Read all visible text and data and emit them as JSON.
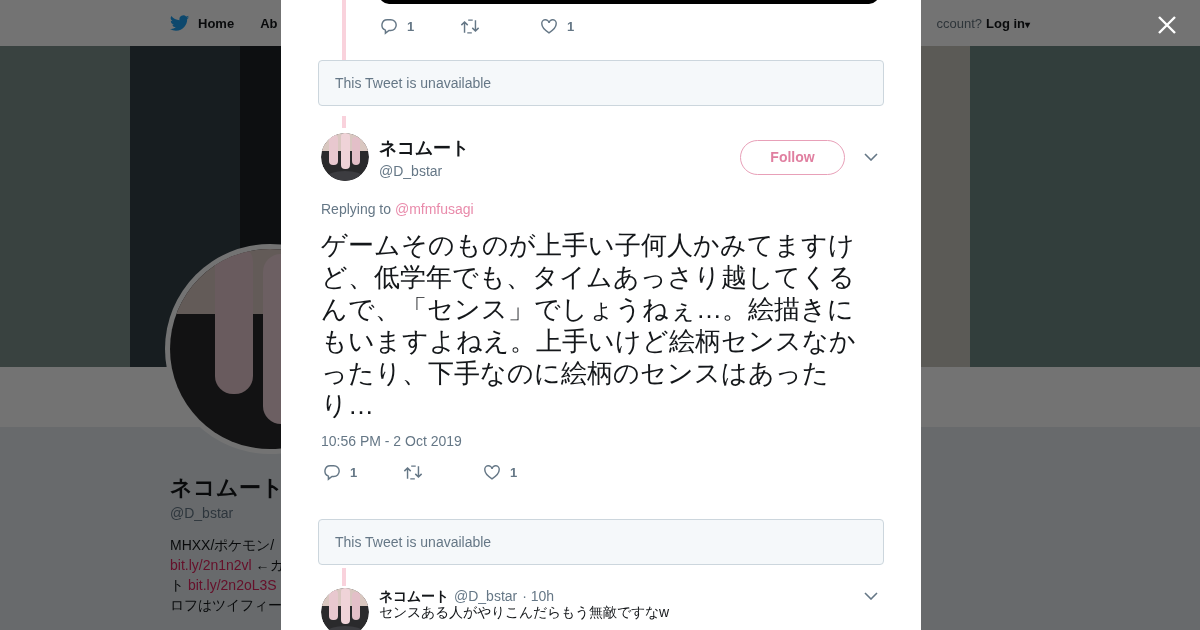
{
  "nav": {
    "items": [
      {
        "label": "Home"
      },
      {
        "label": "Ab"
      }
    ],
    "account_prompt": "ccount?",
    "login": "Log in",
    "login_caret": "▾"
  },
  "profile": {
    "name": "ネコムート",
    "handle": "@D_bstar",
    "bio": [
      {
        "kind": "text",
        "text": "MHXX/ポケモン/"
      },
      {
        "kind": "mixed",
        "link": "bit.ly/2n1n2vl",
        "text": "←カ"
      },
      {
        "kind": "mixed_pre",
        "pre": "ト",
        "link": "bit.ly/2n2oL3S"
      },
      {
        "kind": "text",
        "text": "ロフはツイフィー"
      }
    ]
  },
  "modal": {
    "previous_tweet": {
      "reply_count": "1",
      "like_count": "1"
    },
    "unavailable_1": "This Tweet is unavailable",
    "tweet": {
      "name": "ネコムート",
      "handle": "@D_bstar",
      "follow": "Follow",
      "replying_label": "Replying to",
      "replying_to": "@mfmfusagi",
      "text": "ゲームそのものが上手い子何人かみてますけど、低学年でも、タイムあっさり越してくるんで、「センス」でしょうねぇ…。絵描きにもいますよねえ。上手いけど絵柄センスなかったり、下手なのに絵柄のセンスはあったり…",
      "timestamp": "10:56 PM - 2 Oct 2019",
      "reply_count": "1",
      "like_count": "1"
    },
    "unavailable_2": "This Tweet is unavailable",
    "reply": {
      "name": "ネコムート",
      "handle": "@D_bstar",
      "time": "· 10h",
      "text": "センスある人がやりこんだらもう無敵ですなw"
    }
  }
}
